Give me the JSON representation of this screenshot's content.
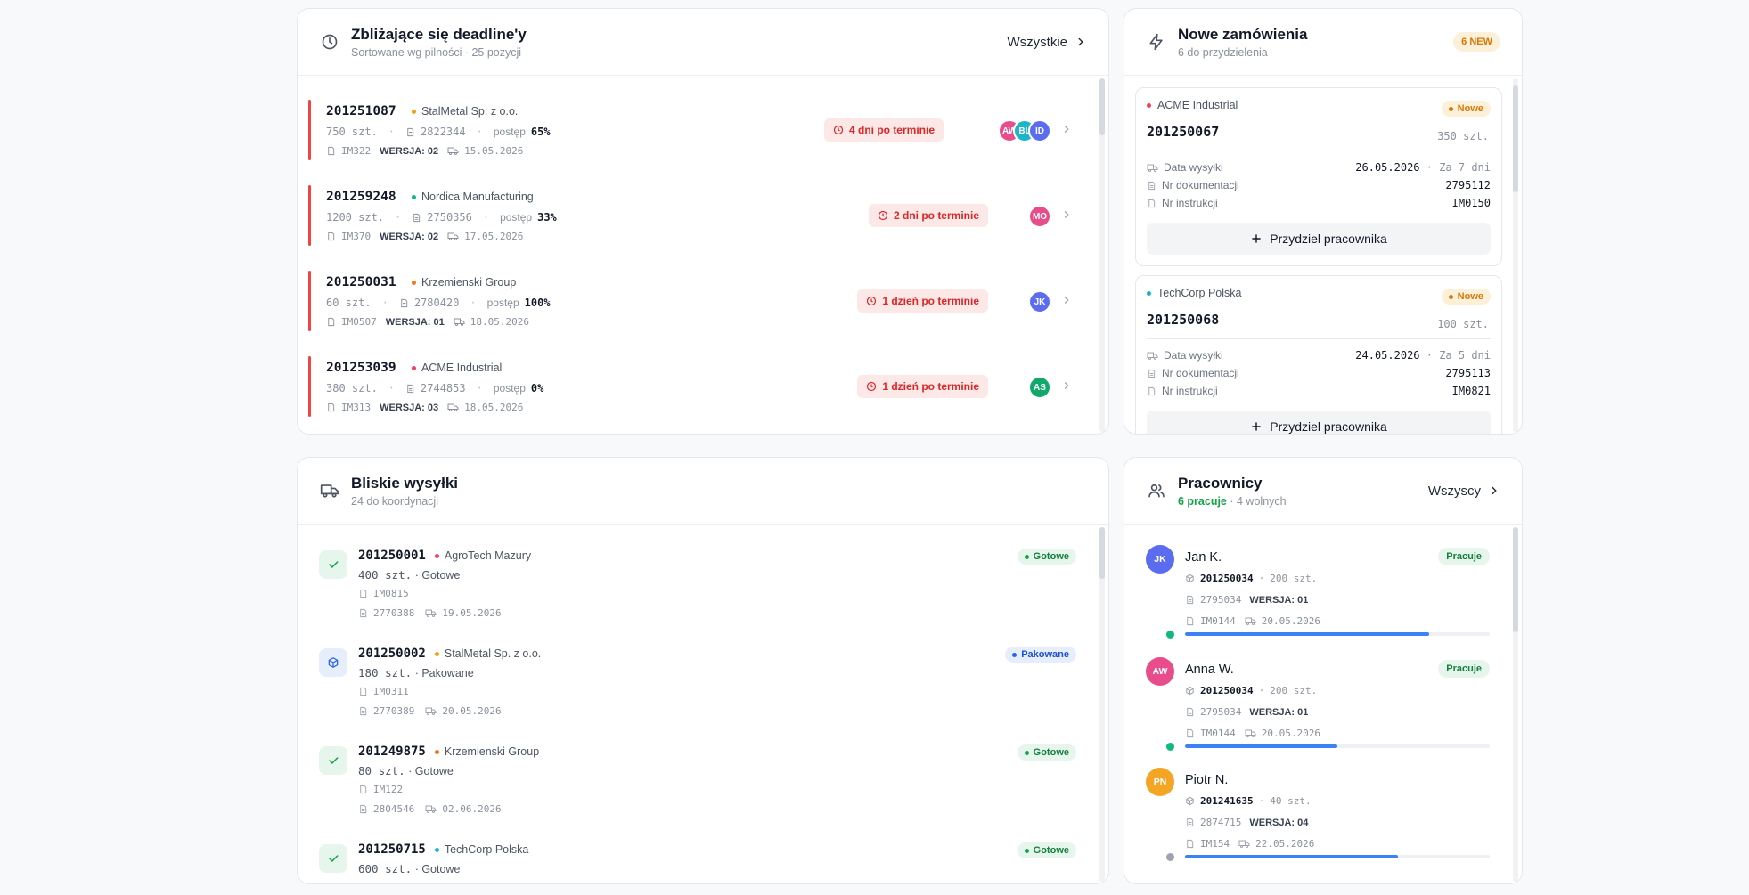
{
  "deadlines": {
    "title": "Zbliżające się deadline'y",
    "subtitle": "Sortowane wg pilności · 25 pozycji",
    "link_label": "Wszystkie",
    "rows": [
      {
        "id": "201251087",
        "client": "StalMetal Sp. z o.o.",
        "client_color": "#f59e0b",
        "qty": "750 szt.",
        "doc": "2822344",
        "progress_label": "postęp",
        "progress": "65%",
        "instr": "IM322",
        "version_label": "WERSJA:",
        "version": "02",
        "date": "15.05.2026",
        "overdue": "4 dni po terminie",
        "avatars": [
          {
            "initials": "AW",
            "color": "#e84c8b"
          },
          {
            "initials": "BL",
            "color": "#1cb5c9"
          },
          {
            "initials": "ID",
            "color": "#5b6cf0"
          }
        ]
      },
      {
        "id": "201259248",
        "client": "Nordica Manufacturing",
        "client_color": "#10b981",
        "qty": "1200 szt.",
        "doc": "2750356",
        "progress_label": "postęp",
        "progress": "33%",
        "instr": "IM370",
        "version_label": "WERSJA:",
        "version": "02",
        "date": "17.05.2026",
        "overdue": "2 dni po terminie",
        "avatars": [
          {
            "initials": "MO",
            "color": "#e84c8b"
          }
        ]
      },
      {
        "id": "201250031",
        "client": "Krzemienski Group",
        "client_color": "#f97316",
        "qty": "60 szt.",
        "doc": "2780420",
        "progress_label": "postęp",
        "progress": "100%",
        "instr": "IM0507",
        "version_label": "WERSJA:",
        "version": "01",
        "date": "18.05.2026",
        "overdue": "1 dzień po terminie",
        "avatars": [
          {
            "initials": "JK",
            "color": "#5b6cf0"
          }
        ]
      },
      {
        "id": "201253039",
        "client": "ACME Industrial",
        "client_color": "#f43f5e",
        "qty": "380 szt.",
        "doc": "2744853",
        "progress_label": "postęp",
        "progress": "0%",
        "instr": "IM313",
        "version_label": "WERSJA:",
        "version": "03",
        "date": "18.05.2026",
        "overdue": "1 dzień po terminie",
        "avatars": [
          {
            "initials": "AS",
            "color": "#10a86b"
          }
        ]
      }
    ]
  },
  "orders": {
    "title": "Nowe zamówienia",
    "subtitle": "6 do przydzielenia",
    "badge": "6 NEW",
    "items": [
      {
        "client": "ACME Industrial",
        "client_color": "#f43f5e",
        "badge": "Nowe",
        "id": "201250067",
        "qty": "350 szt.",
        "ship_label": "Data wysyłki",
        "ship_date": "26.05.2026",
        "ship_rel": "Za 7 dni",
        "doc_label": "Nr dokumentacji",
        "doc": "2795112",
        "instr_label": "Nr instrukcji",
        "instr": "IM0150",
        "assign_label": "Przydziel pracownika"
      },
      {
        "client": "TechCorp Polska",
        "client_color": "#14b8c4",
        "badge": "Nowe",
        "id": "201250068",
        "qty": "100 szt.",
        "ship_label": "Data wysyłki",
        "ship_date": "24.05.2026",
        "ship_rel": "Za 5 dni",
        "doc_label": "Nr dokumentacji",
        "doc": "2795113",
        "instr_label": "Nr instrukcji",
        "instr": "IM0821",
        "assign_label": "Przydziel pracownika"
      }
    ]
  },
  "shipments": {
    "title": "Bliskie wysyłki",
    "subtitle": "24 do koordynacji",
    "rows": [
      {
        "id": "201250001",
        "client": "AgroTech Mazury",
        "client_color": "#f43f5e",
        "qty": "400 szt.",
        "status_text": "Gotowe",
        "instr": "IM0815",
        "doc": "2770388",
        "date": "19.05.2026",
        "badge": "Gotowe",
        "kind": "ready"
      },
      {
        "id": "201250002",
        "client": "StalMetal Sp. z o.o.",
        "client_color": "#f59e0b",
        "qty": "180 szt.",
        "status_text": "Pakowane",
        "instr": "IM0311",
        "doc": "2770389",
        "date": "20.05.2026",
        "badge": "Pakowane",
        "kind": "packing"
      },
      {
        "id": "201249875",
        "client": "Krzemienski Group",
        "client_color": "#f97316",
        "qty": "80 szt.",
        "status_text": "Gotowe",
        "instr": "IM122",
        "doc": "2804546",
        "date": "02.06.2026",
        "badge": "Gotowe",
        "kind": "ready"
      },
      {
        "id": "201250715",
        "client": "TechCorp Polska",
        "client_color": "#14b8c4",
        "qty": "600 szt.",
        "status_text": "Gotowe",
        "instr": "",
        "doc": "",
        "date": "",
        "badge": "Gotowe",
        "kind": "ready"
      }
    ]
  },
  "workers": {
    "title": "Pracownicy",
    "working": "6 pracuje",
    "free": "· 4 wolnych",
    "link_label": "Wszyscy",
    "rows": [
      {
        "initials": "JK",
        "color": "#5b6cf0",
        "name": "Jan K.",
        "badge": "Pracuje",
        "order": "201250034",
        "qty": "200 szt.",
        "doc": "2795034",
        "version_label": "WERSJA:",
        "version": "01",
        "instr": "IM0144",
        "date": "20.05.2026",
        "progress": 0.8,
        "dot": "#10b981"
      },
      {
        "initials": "AW",
        "color": "#e84c8b",
        "name": "Anna W.",
        "badge": "Pracuje",
        "order": "201250034",
        "qty": "200 szt.",
        "doc": "2795034",
        "version_label": "WERSJA:",
        "version": "01",
        "instr": "IM0144",
        "date": "20.05.2026",
        "progress": 0.5,
        "dot": "#10b981"
      },
      {
        "initials": "PN",
        "color": "#f5a524",
        "name": "Piotr N.",
        "badge": "",
        "order": "201241635",
        "qty": "40 szt.",
        "doc": "2874715",
        "version_label": "WERSJA:",
        "version": "04",
        "instr": "IM154",
        "date": "22.05.2026",
        "progress": 0.7,
        "dot": "#9ca3af"
      }
    ]
  }
}
